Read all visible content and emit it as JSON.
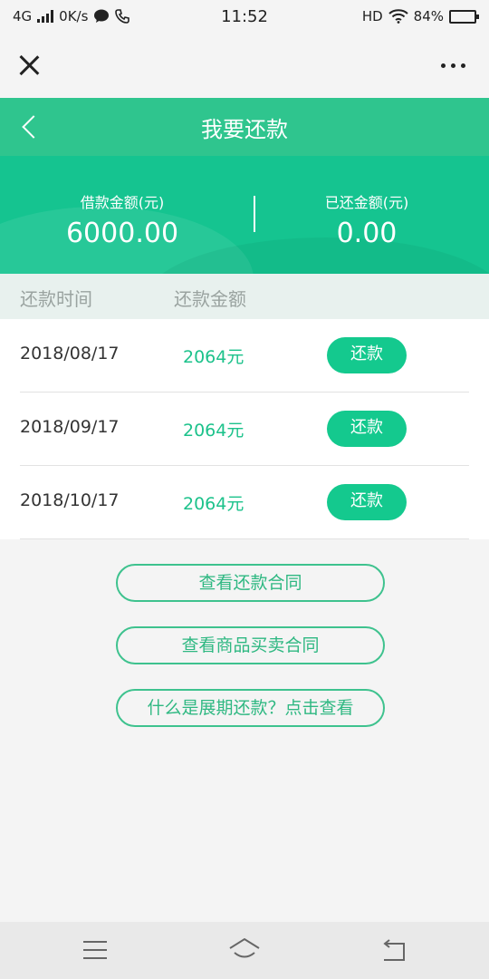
{
  "status_bar": {
    "network": "4G",
    "speed": "0K/s",
    "time": "11:52",
    "hd": "HD",
    "battery": "84%",
    "battery_level": 0.84
  },
  "nav": {
    "title": "我要还款"
  },
  "summary": {
    "loan_label": "借款金额(元)",
    "loan_value": "6000.00",
    "repaid_label": "已还金额(元)",
    "repaid_value": "0.00"
  },
  "table": {
    "headers": [
      "还款时间",
      "还款金额"
    ],
    "rows": [
      {
        "date": "2018/08/17",
        "amount": "2064元",
        "action": "还款"
      },
      {
        "date": "2018/09/17",
        "amount": "2064元",
        "action": "还款"
      },
      {
        "date": "2018/10/17",
        "amount": "2064元",
        "action": "还款"
      }
    ]
  },
  "links": {
    "repayment_contract": "查看还款合同",
    "sale_contract": "查看商品买卖合同",
    "extension_info": "什么是展期还款？点击查看"
  },
  "colors": {
    "primary": "#2fc58e",
    "button": "#14c98e",
    "amount_text": "#1cc28b"
  }
}
